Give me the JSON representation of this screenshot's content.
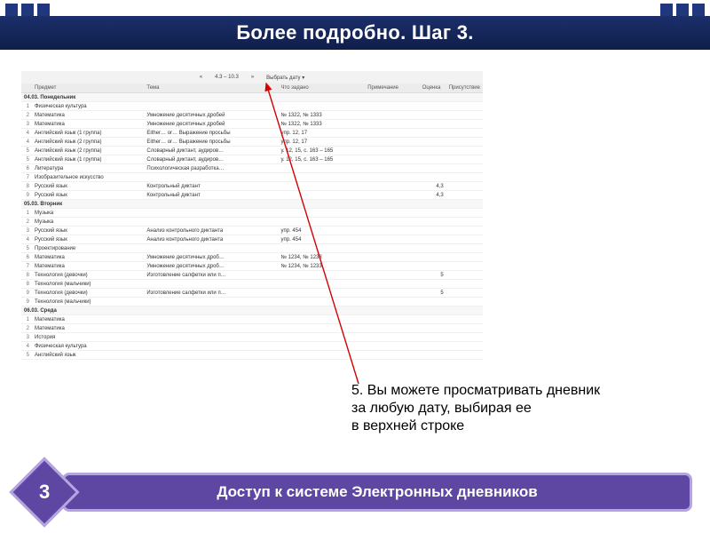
{
  "slide": {
    "title": "Более подробно. Шаг 3.",
    "step_number": "3",
    "footer": "Доступ к системе Электронных дневников",
    "explanation_lines": [
      "5. Вы можете просматривать дневник",
      "за любую дату, выбирая ее",
      " в верхней строке"
    ]
  },
  "diary": {
    "toolbar": {
      "prev": "«",
      "range": "4.3 – 10.3",
      "next": "»",
      "picker": "Выбрать дату ▾"
    },
    "columns": [
      "",
      "Предмет",
      "Тема",
      "Что задано",
      "Примечание",
      "Оценка",
      "Присутствие"
    ],
    "days": [
      {
        "heading": "04.03. Понедельник",
        "rows": [
          {
            "n": "1",
            "subj": "Физическая культура",
            "topic": "",
            "hw": "",
            "note": "",
            "grade": "",
            "att": ""
          },
          {
            "n": "2",
            "subj": "Математика",
            "topic": "Умножение десятичных дробей",
            "hw": "№ 1322, № 1333",
            "note": "",
            "grade": "",
            "att": ""
          },
          {
            "n": "3",
            "subj": "Математика",
            "topic": "Умножение десятичных дробей",
            "hw": "№ 1322, № 1333",
            "note": "",
            "grade": "",
            "att": ""
          },
          {
            "n": "4",
            "subj": "Английский язык (1 группа)",
            "topic": "Either… or… Выражение просьбы",
            "hw": "упр. 12, 17",
            "note": "",
            "grade": "",
            "att": ""
          },
          {
            "n": "4",
            "subj": "Английский язык (2 группа)",
            "topic": "Either… or… Выражение просьбы",
            "hw": "упр. 12, 17",
            "note": "",
            "grade": "",
            "att": ""
          },
          {
            "n": "5",
            "subj": "Английский язык (2 группа)",
            "topic": "Словарный диктант, аудиров…",
            "hw": "у. 12, 15, с. 163 – 165",
            "note": "",
            "grade": "",
            "att": ""
          },
          {
            "n": "5",
            "subj": "Английский язык (1 группа)",
            "topic": "Словарный диктант, аудиров…",
            "hw": "у. 12, 15, с. 163 – 165",
            "note": "",
            "grade": "",
            "att": ""
          },
          {
            "n": "6",
            "subj": "Литература",
            "topic": "Психологическая разработка…",
            "hw": "",
            "note": "",
            "grade": "",
            "att": ""
          },
          {
            "n": "7",
            "subj": "Изобразительное искусство",
            "topic": "",
            "hw": "",
            "note": "",
            "grade": "",
            "att": ""
          },
          {
            "n": "8",
            "subj": "Русский язык",
            "topic": "Контрольный диктант",
            "hw": "",
            "note": "",
            "grade": "4,3",
            "att": ""
          },
          {
            "n": "9",
            "subj": "Русский язык",
            "topic": "Контрольный диктант",
            "hw": "",
            "note": "",
            "grade": "4,3",
            "att": ""
          }
        ]
      },
      {
        "heading": "05.03. Вторник",
        "rows": [
          {
            "n": "1",
            "subj": "Музыка",
            "topic": "",
            "hw": "",
            "note": "",
            "grade": "",
            "att": ""
          },
          {
            "n": "2",
            "subj": "Музыка",
            "topic": "",
            "hw": "",
            "note": "",
            "grade": "",
            "att": ""
          },
          {
            "n": "3",
            "subj": "Русский язык",
            "topic": "Анализ контрольного диктанта",
            "hw": "упр. 454",
            "note": "",
            "grade": "",
            "att": ""
          },
          {
            "n": "4",
            "subj": "Русский язык",
            "topic": "Анализ контрольного диктанта",
            "hw": "упр. 454",
            "note": "",
            "grade": "",
            "att": ""
          },
          {
            "n": "5",
            "subj": "Проектирование",
            "topic": "",
            "hw": "",
            "note": "",
            "grade": "",
            "att": ""
          },
          {
            "n": "6",
            "subj": "Математика",
            "topic": "Умножение десятичных дроб…",
            "hw": "№ 1234, № 1233",
            "note": "",
            "grade": "",
            "att": ""
          },
          {
            "n": "7",
            "subj": "Математика",
            "topic": "Умножение десятичных дроб…",
            "hw": "№ 1234, № 1233",
            "note": "",
            "grade": "",
            "att": ""
          },
          {
            "n": "8",
            "subj": "Технология (девочки)",
            "topic": "Изготовление салфетки или п…",
            "hw": "",
            "note": "",
            "grade": "5",
            "att": ""
          },
          {
            "n": "8",
            "subj": "Технология (мальчики)",
            "topic": "",
            "hw": "",
            "note": "",
            "grade": "",
            "att": ""
          },
          {
            "n": "9",
            "subj": "Технология (девочки)",
            "topic": "Изготовление салфетки или п…",
            "hw": "",
            "note": "",
            "grade": "5",
            "att": ""
          },
          {
            "n": "9",
            "subj": "Технология (мальчики)",
            "topic": "",
            "hw": "",
            "note": "",
            "grade": "",
            "att": ""
          }
        ]
      },
      {
        "heading": "06.03. Среда",
        "rows": [
          {
            "n": "1",
            "subj": "Математика",
            "topic": "",
            "hw": "",
            "note": "",
            "grade": "",
            "att": ""
          },
          {
            "n": "2",
            "subj": "Математика",
            "topic": "",
            "hw": "",
            "note": "",
            "grade": "",
            "att": ""
          },
          {
            "n": "3",
            "subj": "История",
            "topic": "",
            "hw": "",
            "note": "",
            "grade": "",
            "att": ""
          },
          {
            "n": "4",
            "subj": "Физическая культура",
            "topic": "",
            "hw": "",
            "note": "",
            "grade": "",
            "att": ""
          },
          {
            "n": "5",
            "subj": "Английский язык",
            "topic": "",
            "hw": "",
            "note": "",
            "grade": "",
            "att": ""
          }
        ]
      }
    ]
  }
}
